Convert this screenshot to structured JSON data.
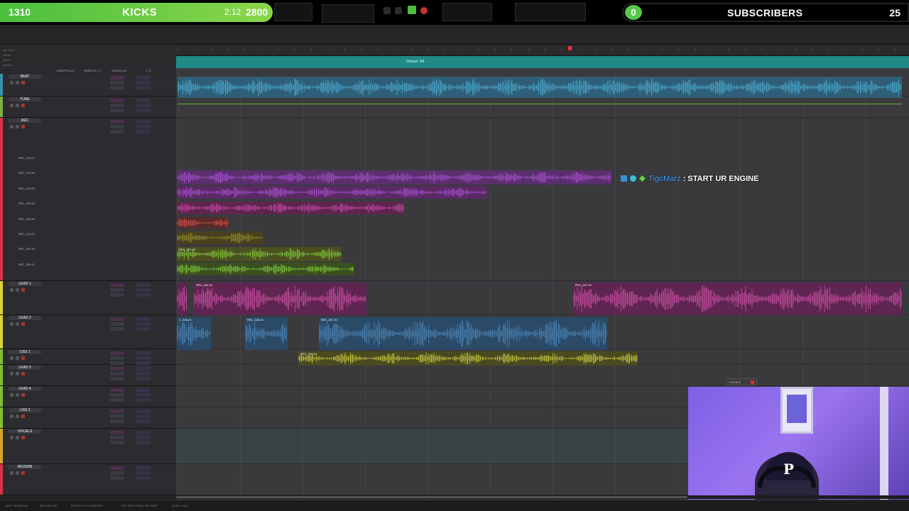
{
  "overlay": {
    "followers_count": "1310",
    "followers_title": "KICKS",
    "followers_time": "2:12",
    "followers_goal": "2800",
    "subs_count": "0",
    "subs_label": "SUBSCRIBERS",
    "subs_goal": "25"
  },
  "chat": {
    "username": "TigoMarz",
    "separator": ":",
    "message": "START UR ENGINE"
  },
  "marker_label": "Default: 4/4",
  "ruler_lines": [
    "Min:Secs",
    "Tempo",
    "Meter",
    "Markers"
  ],
  "mix_header": [
    "INSERTS A-E",
    "INSERTS F-J",
    "SENDS A-E",
    "I / O"
  ],
  "tracks": [
    {
      "name": "BEAT",
      "color": "#3a8fb0"
    },
    {
      "name": "TUNE",
      "color": "#7fae44"
    },
    {
      "name": "REC",
      "color": "#d9324a"
    },
    {
      "name": "LEAD 1",
      "color": "#d9d23a"
    },
    {
      "name": "LEAD 2",
      "color": "#d9d23a"
    },
    {
      "name": "LISS 1",
      "color": "#7fbf3a"
    },
    {
      "name": "LEAD 3",
      "color": "#7fbf3a"
    },
    {
      "name": "LEAD 4",
      "color": "#7fbf3a"
    },
    {
      "name": "LISS 2",
      "color": "#7fbf3a"
    },
    {
      "name": "VOCALS",
      "color": "#d9a32a"
    },
    {
      "name": "REVERB",
      "color": "#d9324a"
    }
  ],
  "rec_subtracks": [
    "REC_113-01",
    "REC_123-05",
    "REC_144-01",
    "REC_155-01",
    "REC_183-01",
    "REC_214-01",
    "REC_257-03",
    "REC_283-01"
  ],
  "clips": {
    "lead1_a": "REC_264-01",
    "lead1_b": "REC_347-01",
    "lead2_a": "C_328-01",
    "lead2_b": "REC_326-01",
    "lead2_c": "REC_307-01",
    "liss1_a": "REC_312-01",
    "rec_mid": "REC_271-03"
  },
  "send_labels": {
    "reverb": "REVERB",
    "delay": "DELAY"
  },
  "vocals_float": "VOCALS",
  "bottom_bar": [
    "EDIT WINDOW",
    "MELODYNE",
    "REPITCH ELEMENTS",
    "RX SPECTRAL EDITOR",
    "SYNC VOX"
  ],
  "colors": {
    "beat": "#4aa3c9",
    "purple": "#a34fc7",
    "pink": "#c04a9c",
    "olive": "#8a8a2a",
    "green": "#7fbf3a",
    "blue": "#4a7fb0",
    "marker": "#1f8a85"
  }
}
